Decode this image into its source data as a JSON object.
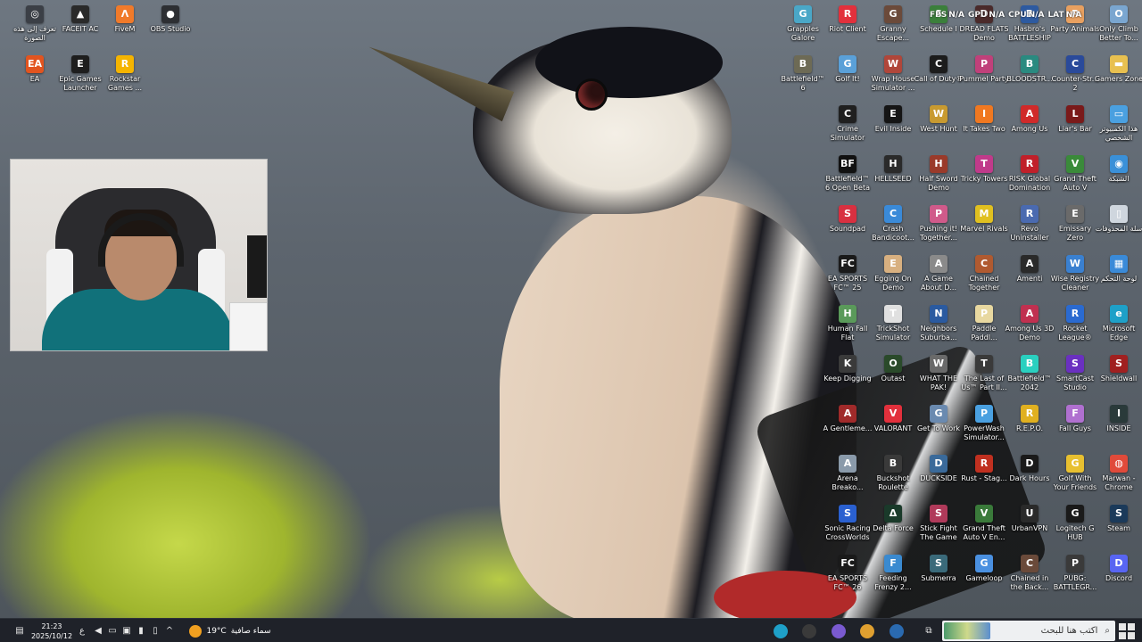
{
  "desktop": {
    "left_icons": [
      {
        "label": "تعرف إلى هذه الصورة",
        "icon": "camera-lens-icon",
        "color": "#3b3f46",
        "glyph": "◎"
      },
      {
        "label": "FACEIT AC",
        "icon": "faceit-icon",
        "color": "#2a2a2a",
        "glyph": "▲"
      },
      {
        "label": "FiveM",
        "icon": "fivem-icon",
        "color": "#f07a2a",
        "glyph": "Λ"
      },
      {
        "label": "OBS Studio",
        "icon": "obs-icon",
        "color": "#2d2f33",
        "glyph": "●"
      },
      {
        "label": "EA",
        "icon": "ea-icon",
        "color": "#e2541f",
        "glyph": "EA"
      },
      {
        "label": "Epic Games Launcher",
        "icon": "epic-games-icon",
        "color": "#1e1e1e",
        "glyph": "E"
      },
      {
        "label": "Rockstar Games ...",
        "icon": "rockstar-icon",
        "color": "#f5b400",
        "glyph": "R"
      }
    ],
    "right_icons": [
      {
        "label": "Grapples Galore",
        "icon": "game-icon",
        "color": "#4aa7c7",
        "glyph": "G"
      },
      {
        "label": "Riot Client",
        "icon": "riot-icon",
        "color": "#e2303c",
        "glyph": "R"
      },
      {
        "label": "Granny Escape...",
        "icon": "game-icon",
        "color": "#6b4a3a",
        "glyph": "G"
      },
      {
        "label": "Schedule I",
        "icon": "game-icon",
        "color": "#3b7f3b",
        "glyph": "S"
      },
      {
        "label": "DREAD FLATS Demo",
        "icon": "game-icon",
        "color": "#4a2a2a",
        "glyph": "D"
      },
      {
        "label": "Hasbro's BATTLESHIP",
        "icon": "game-icon",
        "color": "#2d5aa0",
        "glyph": "B"
      },
      {
        "label": "Party Animals",
        "icon": "game-icon",
        "color": "#e8a060",
        "glyph": "P"
      },
      {
        "label": "Only Climb Better To...",
        "icon": "game-icon",
        "color": "#7aa6d0",
        "glyph": "O"
      },
      {
        "label": "Battlefield™ 6",
        "icon": "game-icon",
        "color": "#6d6a55",
        "glyph": "B"
      },
      {
        "label": "Golf It!",
        "icon": "game-icon",
        "color": "#5aa0d8",
        "glyph": "G"
      },
      {
        "label": "Wrap House Simulator ...",
        "icon": "game-icon",
        "color": "#b0463a",
        "glyph": "W"
      },
      {
        "label": "Call of Duty®",
        "icon": "game-icon",
        "color": "#1c1c1c",
        "glyph": "C"
      },
      {
        "label": "Pummel Party",
        "icon": "game-icon",
        "color": "#c0407a",
        "glyph": "P"
      },
      {
        "label": "BLOODSTR...",
        "icon": "game-icon",
        "color": "#2a8a80",
        "glyph": "B"
      },
      {
        "label": "Counter-Str... 2",
        "icon": "game-icon",
        "color": "#2a4a9a",
        "glyph": "C"
      },
      {
        "label": "Gamers Zone",
        "icon": "folder-icon",
        "color": "#e8c050",
        "glyph": "▬"
      },
      {
        "label": "",
        "icon": "",
        "color": "",
        "glyph": ""
      },
      {
        "label": "Crime Simulator",
        "icon": "game-icon",
        "color": "#202020",
        "glyph": "C"
      },
      {
        "label": "Evil Inside",
        "icon": "game-icon",
        "color": "#151515",
        "glyph": "E"
      },
      {
        "label": "West Hunt",
        "icon": "game-icon",
        "color": "#c89a30",
        "glyph": "W"
      },
      {
        "label": "It Takes Two",
        "icon": "game-icon",
        "color": "#f07820",
        "glyph": "I"
      },
      {
        "label": "Among Us",
        "icon": "game-icon",
        "color": "#d02a2a",
        "glyph": "A"
      },
      {
        "label": "Liar's Bar",
        "icon": "game-icon",
        "color": "#7a1a1a",
        "glyph": "L"
      },
      {
        "label": "هذا الكمبيوتر الشخصي",
        "icon": "this-pc-icon",
        "color": "#4aa0e0",
        "glyph": "▭"
      },
      {
        "label": "",
        "icon": "",
        "color": "",
        "glyph": ""
      },
      {
        "label": "Battlefield™ 6 Open Beta",
        "icon": "game-icon",
        "color": "#111111",
        "glyph": "BF"
      },
      {
        "label": "HELLSEED",
        "icon": "game-icon",
        "color": "#2a2a2a",
        "glyph": "H"
      },
      {
        "label": "Half Sword Demo",
        "icon": "game-icon",
        "color": "#9a3a2a",
        "glyph": "H"
      },
      {
        "label": "Tricky Towers",
        "icon": "game-icon",
        "color": "#c03a8a",
        "glyph": "T"
      },
      {
        "label": "RISK Global Domination",
        "icon": "game-icon",
        "color": "#c0202a",
        "glyph": "R"
      },
      {
        "label": "Grand Theft Auto V",
        "icon": "game-icon",
        "color": "#3a8a3a",
        "glyph": "V"
      },
      {
        "label": "الشبكة",
        "icon": "network-icon",
        "color": "#3a90d8",
        "glyph": "◉"
      },
      {
        "label": "",
        "icon": "",
        "color": "",
        "glyph": ""
      },
      {
        "label": "Soundpad",
        "icon": "game-icon",
        "color": "#d83040",
        "glyph": "S"
      },
      {
        "label": "Crash Bandicoot...",
        "icon": "game-icon",
        "color": "#3a8ad8",
        "glyph": "C"
      },
      {
        "label": "Pushing it! Together...",
        "icon": "game-icon",
        "color": "#d05a8a",
        "glyph": "P"
      },
      {
        "label": "Marvel Rivals",
        "icon": "game-icon",
        "color": "#e0c020",
        "glyph": "M"
      },
      {
        "label": "Revo Uninstaller",
        "icon": "game-icon",
        "color": "#4a6ab0",
        "glyph": "R"
      },
      {
        "label": "Emissary Zero",
        "icon": "game-icon",
        "color": "#6a6a6a",
        "glyph": "E"
      },
      {
        "label": "سلة المحذوفات",
        "icon": "recycle-bin-icon",
        "color": "#cfd6de",
        "glyph": "▯"
      },
      {
        "label": "",
        "icon": "",
        "color": "",
        "glyph": ""
      },
      {
        "label": "EA SPORTS FC™ 25",
        "icon": "game-icon",
        "color": "#1a1a1a",
        "glyph": "FC"
      },
      {
        "label": "Egging On Demo",
        "icon": "game-icon",
        "color": "#d8b080",
        "glyph": "E"
      },
      {
        "label": "A Game About D...",
        "icon": "game-icon",
        "color": "#8a8a8a",
        "glyph": "A"
      },
      {
        "label": "Chained Together",
        "icon": "game-icon",
        "color": "#b05a30",
        "glyph": "C"
      },
      {
        "label": "Amenti",
        "icon": "game-icon",
        "color": "#2a2a2a",
        "glyph": "A"
      },
      {
        "label": "Wise Registry Cleaner",
        "icon": "game-icon",
        "color": "#3a80d0",
        "glyph": "W"
      },
      {
        "label": "لوحة التحكم",
        "icon": "control-panel-icon",
        "color": "#3a8ad8",
        "glyph": "▦"
      },
      {
        "label": "",
        "icon": "",
        "color": "",
        "glyph": ""
      },
      {
        "label": "Human Fall Flat",
        "icon": "game-icon",
        "color": "#5a9a5a",
        "glyph": "H"
      },
      {
        "label": "TrickShot Simulator",
        "icon": "game-icon",
        "color": "#e0e0e0",
        "glyph": "T"
      },
      {
        "label": "Neighbors Suburba...",
        "icon": "game-icon",
        "color": "#2a5aa0",
        "glyph": "N"
      },
      {
        "label": "Paddle Paddl...",
        "icon": "game-icon",
        "color": "#e8d8a0",
        "glyph": "P"
      },
      {
        "label": "Among Us 3D Demo",
        "icon": "game-icon",
        "color": "#c03050",
        "glyph": "A"
      },
      {
        "label": "Rocket League®",
        "icon": "game-icon",
        "color": "#2a6ad0",
        "glyph": "R"
      },
      {
        "label": "Microsoft Edge",
        "icon": "edge-icon",
        "color": "#1ea0c8",
        "glyph": "e"
      },
      {
        "label": "",
        "icon": "",
        "color": "",
        "glyph": ""
      },
      {
        "label": "Keep Digging",
        "icon": "game-icon",
        "color": "#3a3a3a",
        "glyph": "K"
      },
      {
        "label": "Outast",
        "icon": "game-icon",
        "color": "#2a4a2a",
        "glyph": "O"
      },
      {
        "label": "WHAT THE PAK!",
        "icon": "game-icon",
        "color": "#6a6a6a",
        "glyph": "W"
      },
      {
        "label": "The Last of Us™ Part II...",
        "icon": "game-icon",
        "color": "#3a3a3a",
        "glyph": "T"
      },
      {
        "label": "Battlefield™ 2042",
        "icon": "game-icon",
        "color": "#2ad0c0",
        "glyph": "B"
      },
      {
        "label": "SmartCast Studio",
        "icon": "game-icon",
        "color": "#6a30c0",
        "glyph": "S"
      },
      {
        "label": "Shieldwall",
        "icon": "game-icon",
        "color": "#a02020",
        "glyph": "S"
      },
      {
        "label": "",
        "icon": "",
        "color": "",
        "glyph": ""
      },
      {
        "label": "A Gentleme...",
        "icon": "game-icon",
        "color": "#a02a2a",
        "glyph": "A"
      },
      {
        "label": "VALORANT",
        "icon": "valorant-icon",
        "color": "#e2303c",
        "glyph": "V"
      },
      {
        "label": "Get To Work",
        "icon": "game-icon",
        "color": "#6a8ab0",
        "glyph": "G"
      },
      {
        "label": "PowerWash Simulator...",
        "icon": "game-icon",
        "color": "#4aa0e0",
        "glyph": "P"
      },
      {
        "label": "R.E.P.O.",
        "icon": "game-icon",
        "color": "#e0b020",
        "glyph": "R"
      },
      {
        "label": "Fall Guys",
        "icon": "game-icon",
        "color": "#b070d0",
        "glyph": "F"
      },
      {
        "label": "INSIDE",
        "icon": "game-icon",
        "color": "#2a3a3a",
        "glyph": "I"
      },
      {
        "label": "",
        "icon": "",
        "color": "",
        "glyph": ""
      },
      {
        "label": "Arena Breako...",
        "icon": "game-icon",
        "color": "#8a9aaa",
        "glyph": "A"
      },
      {
        "label": "Buckshot Roulette",
        "icon": "game-icon",
        "color": "#3a3a3a",
        "glyph": "B"
      },
      {
        "label": "DUCKSIDE",
        "icon": "game-icon",
        "color": "#3a6a9a",
        "glyph": "D"
      },
      {
        "label": "Rust - Stag...",
        "icon": "game-icon",
        "color": "#c03020",
        "glyph": "R"
      },
      {
        "label": "Dark Hours",
        "icon": "game-icon",
        "color": "#1a1a1a",
        "glyph": "D"
      },
      {
        "label": "Golf With Your Friends",
        "icon": "game-icon",
        "color": "#e8c030",
        "glyph": "G"
      },
      {
        "label": "Marwan - Chrome",
        "icon": "chrome-icon",
        "color": "#e04a3a",
        "glyph": "◍"
      },
      {
        "label": "",
        "icon": "",
        "color": "",
        "glyph": ""
      },
      {
        "label": "Sonic Racing CrossWorlds",
        "icon": "game-icon",
        "color": "#2a60d0",
        "glyph": "S"
      },
      {
        "label": "Delta Force",
        "icon": "game-icon",
        "color": "#1a3a2a",
        "glyph": "Δ"
      },
      {
        "label": "Stick Fight The Game",
        "icon": "game-icon",
        "color": "#b03a5a",
        "glyph": "S"
      },
      {
        "label": "Grand Theft Auto V En...",
        "icon": "game-icon",
        "color": "#3a7a3a",
        "glyph": "V"
      },
      {
        "label": "UrbanVPN",
        "icon": "game-icon",
        "color": "#2a2a2a",
        "glyph": "U"
      },
      {
        "label": "Logitech G HUB",
        "icon": "game-icon",
        "color": "#1a1a1a",
        "glyph": "G"
      },
      {
        "label": "Steam",
        "icon": "steam-icon",
        "color": "#1b3a5a",
        "glyph": "S"
      },
      {
        "label": "",
        "icon": "",
        "color": "",
        "glyph": ""
      },
      {
        "label": "EA SPORTS FC™ 26",
        "icon": "game-icon",
        "color": "#1a1a1a",
        "glyph": "FC"
      },
      {
        "label": "Feeding Frenzy 2...",
        "icon": "game-icon",
        "color": "#3a8ad0",
        "glyph": "F"
      },
      {
        "label": "Submerra",
        "icon": "game-icon",
        "color": "#3a6a7a",
        "glyph": "S"
      },
      {
        "label": "Gameloop",
        "icon": "game-icon",
        "color": "#4a90e0",
        "glyph": "G"
      },
      {
        "label": "Chained in the Back...",
        "icon": "game-icon",
        "color": "#6a4a3a",
        "glyph": "C"
      },
      {
        "label": "PUBG: BATTLEGR...",
        "icon": "game-icon",
        "color": "#3a3a3a",
        "glyph": "P"
      },
      {
        "label": "Discord",
        "icon": "discord-icon",
        "color": "#5865f2",
        "glyph": "D"
      }
    ]
  },
  "overlay": {
    "fps_label": "FPS",
    "fps_value": "N/A",
    "gpu_label": "GPU",
    "gpu_value": "N/A",
    "cpu_label": "CPU",
    "cpu_value": "N/A",
    "lat_label": "LAT",
    "lat_value": "N/A"
  },
  "taskbar": {
    "search_placeholder": "اكتب هنا للبحث",
    "weather_text": "سماء صافية",
    "temperature": "19°C",
    "clock_time": "21:23",
    "clock_date": "2025/10/12",
    "language": "ع",
    "apps": [
      {
        "name": "edge-taskbar-icon",
        "color": "#1ea0c8"
      },
      {
        "name": "obs-taskbar-icon",
        "color": "#3a3a3a"
      },
      {
        "name": "app-taskbar-icon",
        "color": "#7a5ad0"
      },
      {
        "name": "chrome-taskbar-icon",
        "color": "#e0a030"
      },
      {
        "name": "steam-taskbar-icon",
        "color": "#2a6ab0"
      }
    ]
  }
}
